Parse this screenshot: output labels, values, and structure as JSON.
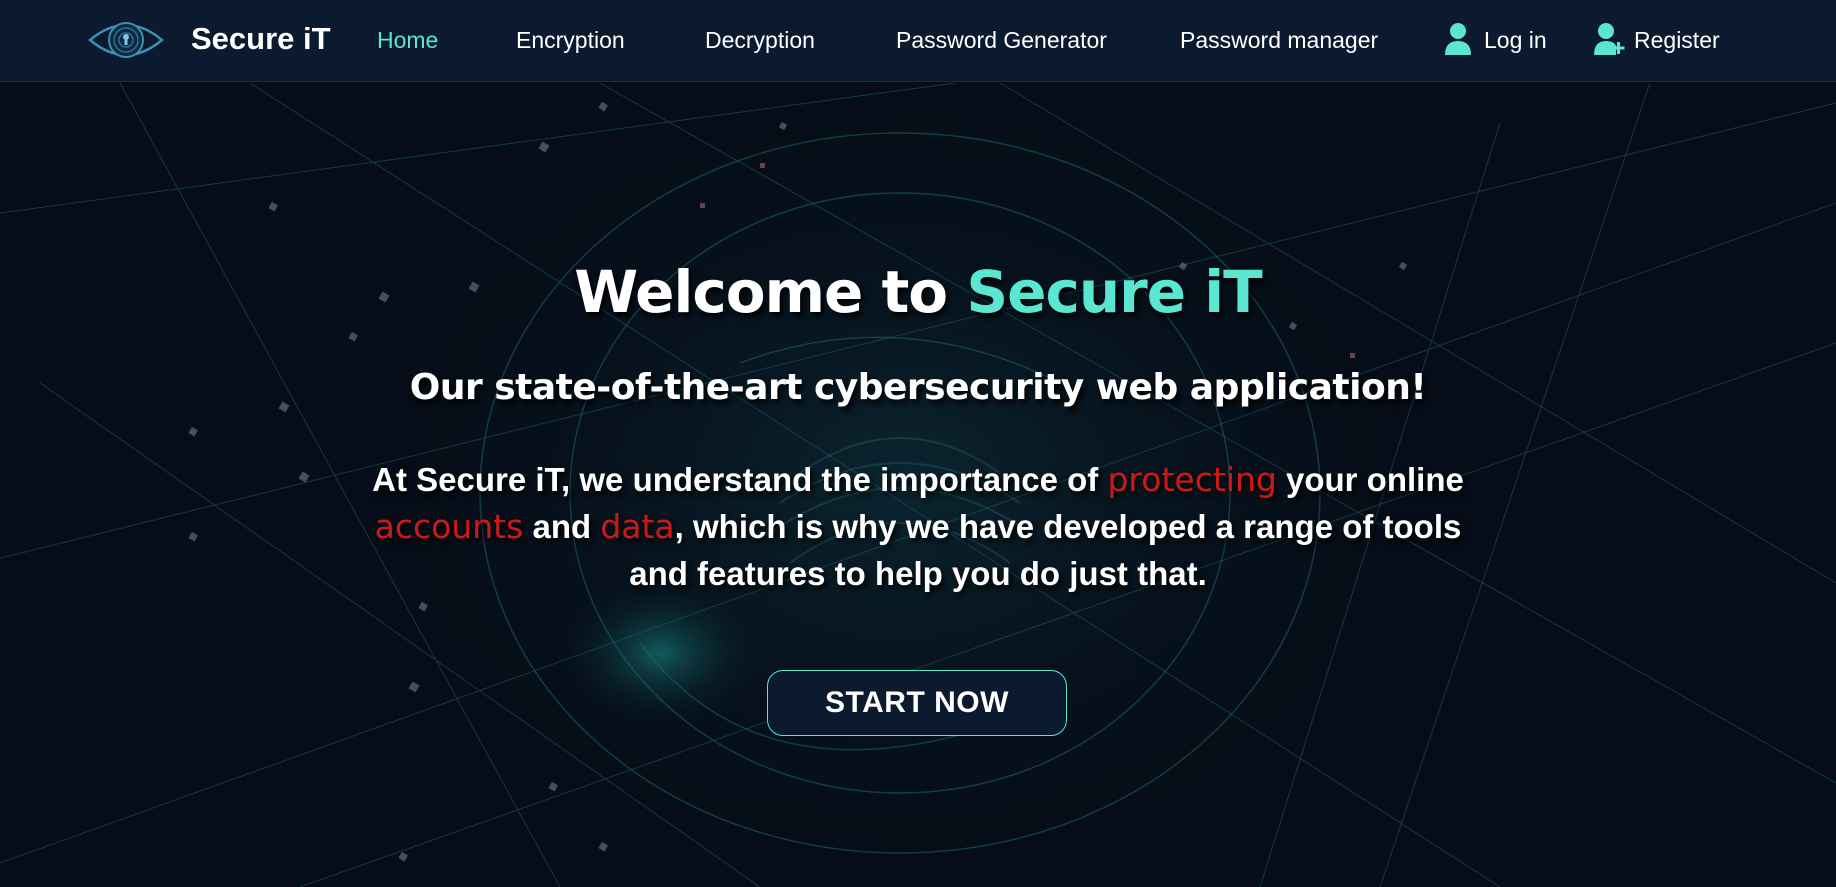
{
  "nav": {
    "brand": "Secure iT",
    "links": [
      "Home",
      "Encryption",
      "Decryption",
      "Password Generator",
      "Password manager"
    ],
    "active": "Home",
    "login_label": "Log in",
    "register_label": "Register"
  },
  "hero": {
    "title_prefix": "Welcome to ",
    "title_accent": "Secure iT",
    "subtitle": "Our state-of-the-art cybersecurity web application!",
    "description": {
      "t1": "At Secure iT, we understand the importance of ",
      "h1": "protecting",
      "t2": " your online ",
      "h2": "accounts",
      "t3": " and ",
      "h3": "data",
      "t4": ", which is why we have developed a range of tools and features to help you do just that."
    },
    "cta_label": "START NOW"
  },
  "colors": {
    "accent": "#5ae6d0",
    "highlight": "#d01818",
    "navbar_bg": "#0b1a2e",
    "page_bg": "#050b14"
  },
  "icons": [
    "eye-lock-logo-icon",
    "user-icon",
    "user-plus-icon"
  ]
}
